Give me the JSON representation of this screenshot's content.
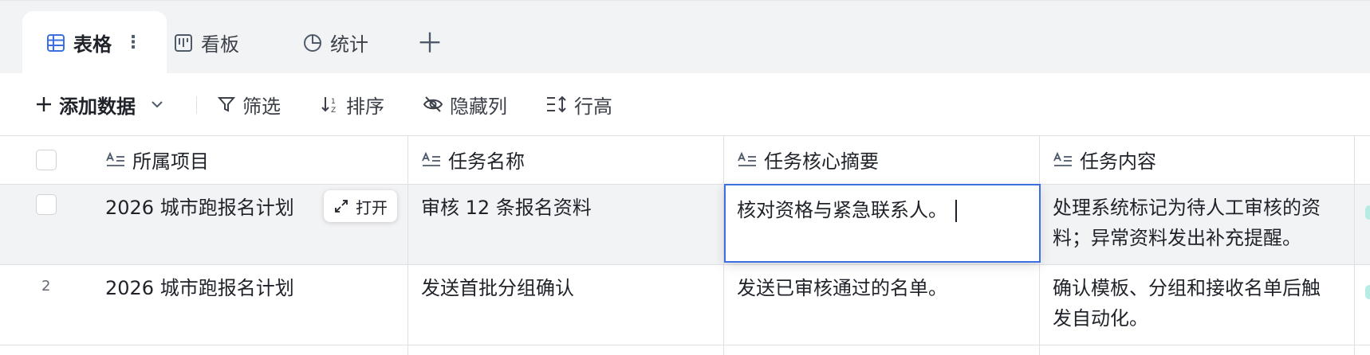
{
  "tabs": [
    {
      "label": "表格",
      "icon": "table-icon",
      "active": true
    },
    {
      "label": "看板",
      "icon": "kanban-icon",
      "active": false
    },
    {
      "label": "统计",
      "icon": "pie-chart-icon",
      "active": false
    }
  ],
  "toolbar": {
    "add_data_label": "添加数据",
    "filter_label": "筛选",
    "sort_label": "排序",
    "hide_columns_label": "隐藏列",
    "row_height_label": "行高"
  },
  "table": {
    "columns": [
      "所属项目",
      "任务名称",
      "任务核心摘要",
      "任务内容"
    ],
    "open_label": "打开",
    "rows": [
      {
        "row_number": "",
        "project": "2026 城市跑报名计划",
        "task_name": "审核 12 条报名资料",
        "summary": "核对资格与紧急联系人。",
        "content_line1": "处理系统标记为待人工审核的资",
        "content_line2": "料；异常资料发出补充提醒。"
      },
      {
        "row_number": "2",
        "project": "2026 城市跑报名计划",
        "task_name": "发送首批分组确认",
        "summary": "发送已审核通过的名单。",
        "content_line1": "确认模板、分组和接收名单后触",
        "content_line2": "发自动化。"
      }
    ]
  },
  "colors": {
    "accent": "#3d6fe0",
    "tabbar_bg": "#f2f3f5",
    "selected_row_bg": "#f2f3f5",
    "border": "#dee0e3"
  }
}
